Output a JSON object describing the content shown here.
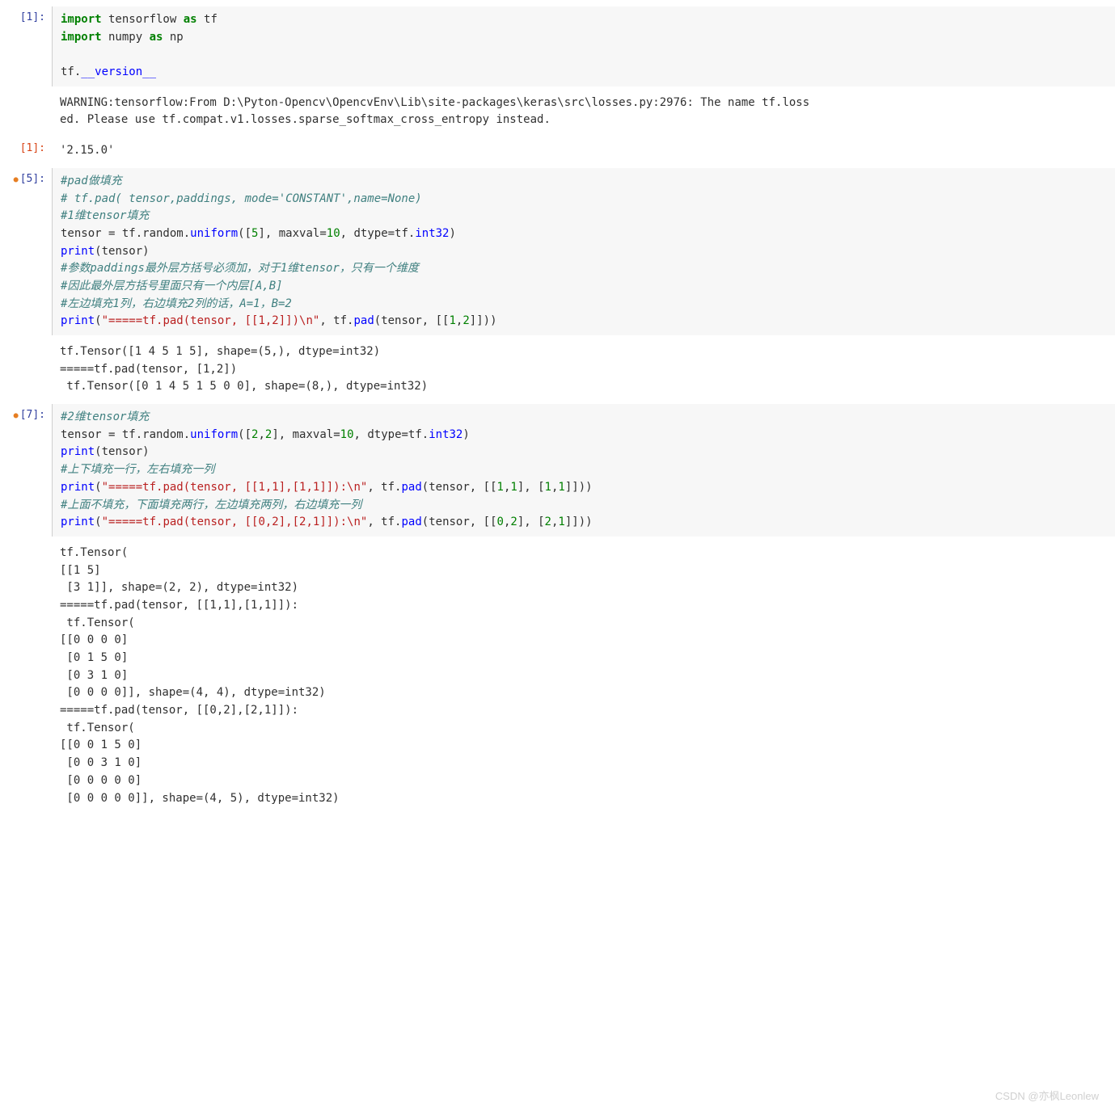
{
  "cells": [
    {
      "id": "cell1_in",
      "prompt": "[1]:",
      "type": "input",
      "modified": false,
      "code_tokens": [
        [
          {
            "t": "import",
            "c": "kw"
          },
          {
            "t": " tensorflow ",
            "c": "nm"
          },
          {
            "t": "as",
            "c": "kw"
          },
          {
            "t": " tf",
            "c": "nm"
          }
        ],
        [
          {
            "t": "import",
            "c": "kw"
          },
          {
            "t": " numpy ",
            "c": "nm"
          },
          {
            "t": "as",
            "c": "kw"
          },
          {
            "t": " np",
            "c": "nm"
          }
        ],
        [
          {
            "t": "",
            "c": "nm"
          }
        ],
        [
          {
            "t": "tf.",
            "c": "nm"
          },
          {
            "t": "__version__",
            "c": "dunder"
          }
        ]
      ]
    },
    {
      "id": "cell1_stderr",
      "prompt": "",
      "type": "output",
      "text": "WARNING:tensorflow:From D:\\Pyton-Opencv\\OpencvEnv\\Lib\\site-packages\\keras\\src\\losses.py:2976: The name tf.loss\ned. Please use tf.compat.v1.losses.sparse_softmax_cross_entropy instead.\n"
    },
    {
      "id": "cell1_out",
      "prompt": "[1]:",
      "type": "result",
      "text": "'2.15.0'"
    },
    {
      "id": "cell5_in",
      "prompt": "[5]:",
      "type": "input",
      "modified": true,
      "code_tokens": [
        [
          {
            "t": "#pad做填充",
            "c": "cmt"
          }
        ],
        [
          {
            "t": "# tf.pad( tensor,paddings, mode='CONSTANT',name=None)",
            "c": "cmt"
          }
        ],
        [
          {
            "t": "#1维tensor填充",
            "c": "cmt"
          }
        ],
        [
          {
            "t": "tensor = tf.random.",
            "c": "nm"
          },
          {
            "t": "uniform",
            "c": "fn"
          },
          {
            "t": "([",
            "c": "nm"
          },
          {
            "t": "5",
            "c": "num"
          },
          {
            "t": "], maxval=",
            "c": "nm"
          },
          {
            "t": "10",
            "c": "num"
          },
          {
            "t": ", dtype=tf.",
            "c": "nm"
          },
          {
            "t": "int32",
            "c": "fn"
          },
          {
            "t": ")",
            "c": "nm"
          }
        ],
        [
          {
            "t": "print",
            "c": "fn"
          },
          {
            "t": "(tensor)",
            "c": "nm"
          }
        ],
        [
          {
            "t": "#参数paddings最外层方括号必须加，对于1维tensor，只有一个维度",
            "c": "cmt"
          }
        ],
        [
          {
            "t": "#因此最外层方括号里面只有一个内层[A,B]",
            "c": "cmt"
          }
        ],
        [
          {
            "t": "#左边填充1列，右边填充2列的话，A=1，B=2",
            "c": "cmt"
          }
        ],
        [
          {
            "t": "print",
            "c": "fn"
          },
          {
            "t": "(",
            "c": "nm"
          },
          {
            "t": "\"=====tf.pad(tensor, [[1,2]])\\n\"",
            "c": "str"
          },
          {
            "t": ", tf.",
            "c": "nm"
          },
          {
            "t": "pad",
            "c": "fn"
          },
          {
            "t": "(tensor, [[",
            "c": "nm"
          },
          {
            "t": "1",
            "c": "num"
          },
          {
            "t": ",",
            "c": "nm"
          },
          {
            "t": "2",
            "c": "num"
          },
          {
            "t": "]]))",
            "c": "nm"
          }
        ]
      ]
    },
    {
      "id": "cell5_out",
      "prompt": "",
      "type": "output",
      "text": "tf.Tensor([1 4 5 1 5], shape=(5,), dtype=int32)\n=====tf.pad(tensor, [1,2])\n tf.Tensor([0 1 4 5 1 5 0 0], shape=(8,), dtype=int32)"
    },
    {
      "id": "cell7_in",
      "prompt": "[7]:",
      "type": "input",
      "modified": true,
      "code_tokens": [
        [
          {
            "t": "#2维tensor填充",
            "c": "cmt"
          }
        ],
        [
          {
            "t": "tensor = tf.random.",
            "c": "nm"
          },
          {
            "t": "uniform",
            "c": "fn"
          },
          {
            "t": "([",
            "c": "nm"
          },
          {
            "t": "2",
            "c": "num"
          },
          {
            "t": ",",
            "c": "nm"
          },
          {
            "t": "2",
            "c": "num"
          },
          {
            "t": "], maxval=",
            "c": "nm"
          },
          {
            "t": "10",
            "c": "num"
          },
          {
            "t": ", dtype=tf.",
            "c": "nm"
          },
          {
            "t": "int32",
            "c": "fn"
          },
          {
            "t": ")",
            "c": "nm"
          }
        ],
        [
          {
            "t": "print",
            "c": "fn"
          },
          {
            "t": "(tensor)",
            "c": "nm"
          }
        ],
        [
          {
            "t": "#上下填充一行，左右填充一列",
            "c": "cmt"
          }
        ],
        [
          {
            "t": "print",
            "c": "fn"
          },
          {
            "t": "(",
            "c": "nm"
          },
          {
            "t": "\"=====tf.pad(tensor, [[1,1],[1,1]]):\\n\"",
            "c": "str"
          },
          {
            "t": ", tf.",
            "c": "nm"
          },
          {
            "t": "pad",
            "c": "fn"
          },
          {
            "t": "(tensor, [[",
            "c": "nm"
          },
          {
            "t": "1",
            "c": "num"
          },
          {
            "t": ",",
            "c": "nm"
          },
          {
            "t": "1",
            "c": "num"
          },
          {
            "t": "], [",
            "c": "nm"
          },
          {
            "t": "1",
            "c": "num"
          },
          {
            "t": ",",
            "c": "nm"
          },
          {
            "t": "1",
            "c": "num"
          },
          {
            "t": "]]))",
            "c": "nm"
          }
        ],
        [
          {
            "t": "#上面不填充，下面填充两行，左边填充两列，右边填充一列",
            "c": "cmt"
          }
        ],
        [
          {
            "t": "print",
            "c": "fn"
          },
          {
            "t": "(",
            "c": "nm"
          },
          {
            "t": "\"=====tf.pad(tensor, [[0,2],[2,1]]):\\n\"",
            "c": "str"
          },
          {
            "t": ", tf.",
            "c": "nm"
          },
          {
            "t": "pad",
            "c": "fn"
          },
          {
            "t": "(tensor, [[",
            "c": "nm"
          },
          {
            "t": "0",
            "c": "num"
          },
          {
            "t": ",",
            "c": "nm"
          },
          {
            "t": "2",
            "c": "num"
          },
          {
            "t": "], [",
            "c": "nm"
          },
          {
            "t": "2",
            "c": "num"
          },
          {
            "t": ",",
            "c": "nm"
          },
          {
            "t": "1",
            "c": "num"
          },
          {
            "t": "]]))",
            "c": "nm"
          }
        ]
      ]
    },
    {
      "id": "cell7_out",
      "prompt": "",
      "type": "output",
      "text": "tf.Tensor(\n[[1 5]\n [3 1]], shape=(2, 2), dtype=int32)\n=====tf.pad(tensor, [[1,1],[1,1]]):\n tf.Tensor(\n[[0 0 0 0]\n [0 1 5 0]\n [0 3 1 0]\n [0 0 0 0]], shape=(4, 4), dtype=int32)\n=====tf.pad(tensor, [[0,2],[2,1]]):\n tf.Tensor(\n[[0 0 1 5 0]\n [0 0 3 1 0]\n [0 0 0 0 0]\n [0 0 0 0 0]], shape=(4, 5), dtype=int32)"
    }
  ],
  "watermark": "CSDN @亦枫Leonlew"
}
